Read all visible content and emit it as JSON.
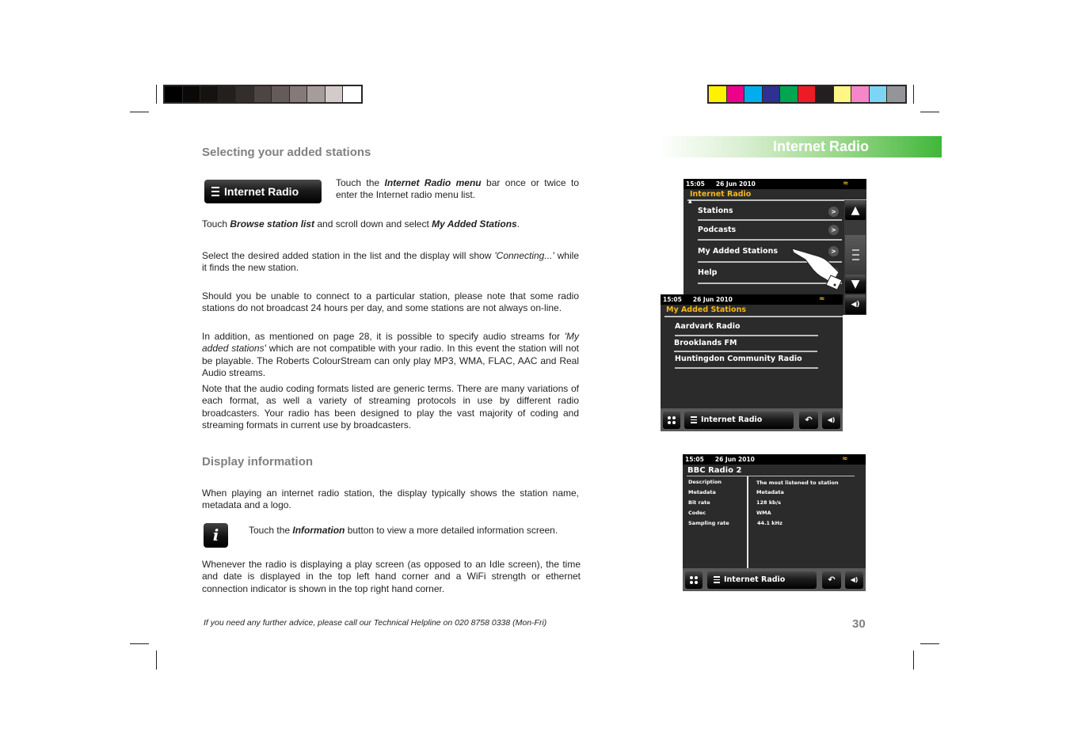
{
  "print_marks": {
    "grayscale_swatches": [
      "#000000",
      "#0a0908",
      "#151212",
      "#231f1e",
      "#332d2c",
      "#4d4542",
      "#655c5a",
      "#857a77",
      "#a69d9b",
      "#d2cbca",
      "#ffffff"
    ],
    "color_swatches": [
      "#fff200",
      "#ec008c",
      "#00aeef",
      "#2e3192",
      "#00a651",
      "#ed1c24",
      "#231f20",
      "#fff685",
      "#f587c8",
      "#7dd5f5",
      "#939598"
    ]
  },
  "banner": {
    "title": "Internet Radio",
    "accent": "#3fb739"
  },
  "section1": {
    "heading": "Selecting your added stations",
    "button_label": "Internet Radio",
    "p1": {
      "a": "Touch the ",
      "b": "Internet Radio menu",
      "c": " bar once or twice to enter the Internet radio menu list."
    },
    "p2": {
      "a": "Touch ",
      "b": "Browse station list",
      "c": " and scroll down and select ",
      "d": "My Added Stations",
      "e": "."
    },
    "p3": {
      "a": "Select the desired added station in the list and the display will show ",
      "b": "'Connecting...'",
      "c": " while it finds the new station."
    },
    "p4": "Should you be unable to connect to a particular station, please note that some radio stations do not broadcast 24 hours per day, and some stations are not always on-line.",
    "p5": {
      "a": "In addition, as mentioned on page 28, it is possible to specify audio streams  for ",
      "b": "'My added stations'",
      "c": " which are not compatible with your radio. In this event the station will not be playable. The Roberts ColourStream can only play MP3, WMA, FLAC, AAC and Real Audio streams."
    },
    "p6": "Note that the audio coding formats listed are generic terms. There are many variations of each format, as well a variety of streaming protocols in use by different radio broadcasters. Your radio has been designed to play the vast majority of coding and streaming formats in current use by broadcasters."
  },
  "section2": {
    "heading": "Display information",
    "p1": "When playing an internet radio station, the display typically shows the station name, metadata and a logo.",
    "info_icon": "i",
    "p2": {
      "a": "Touch the ",
      "b": "Information",
      "c": " button to view a more detailed information screen."
    },
    "p3": "Whenever the radio is displaying a play screen (as opposed to an Idle screen), the time and date is displayed in the top left hand corner and a WiFi strength or ethernet connection indicator is shown in the top right hand corner."
  },
  "screen1": {
    "time": "15:05",
    "date": "26 Jun 2010",
    "title": "Internet Radio",
    "items": [
      {
        "label": "Stations",
        "chevron": ">"
      },
      {
        "label": "Podcasts",
        "chevron": ">"
      },
      {
        "label": "My Added Stations",
        "chevron": ">"
      },
      {
        "label": "Help",
        "chevron": ">"
      }
    ]
  },
  "screen2": {
    "time": "15:05",
    "date": "26 Jun 2010",
    "title": "My Added Stations",
    "items": [
      "Aardvark Radio",
      "Brooklands FM",
      "Huntingdon Community Radio"
    ],
    "footer_label": "Internet Radio"
  },
  "screen3": {
    "time": "15:05",
    "date": "26 Jun 2010",
    "title": "BBC Radio 2",
    "rows": [
      {
        "label": "Description",
        "value": "The most listened to station"
      },
      {
        "label": "Metadata",
        "value": "Metadata"
      },
      {
        "label": "Bit rate",
        "value": "128 kb/s"
      },
      {
        "label": "Codec",
        "value": "WMA"
      },
      {
        "label": "Sampling rate",
        "value": "44.1 kHz"
      }
    ],
    "footer_label": "Internet Radio"
  },
  "footer": {
    "helpline": "If you need any further advice, please call our Technical Helpline on 020 8758 0338 (Mon-Fri)",
    "page_number": "30"
  }
}
